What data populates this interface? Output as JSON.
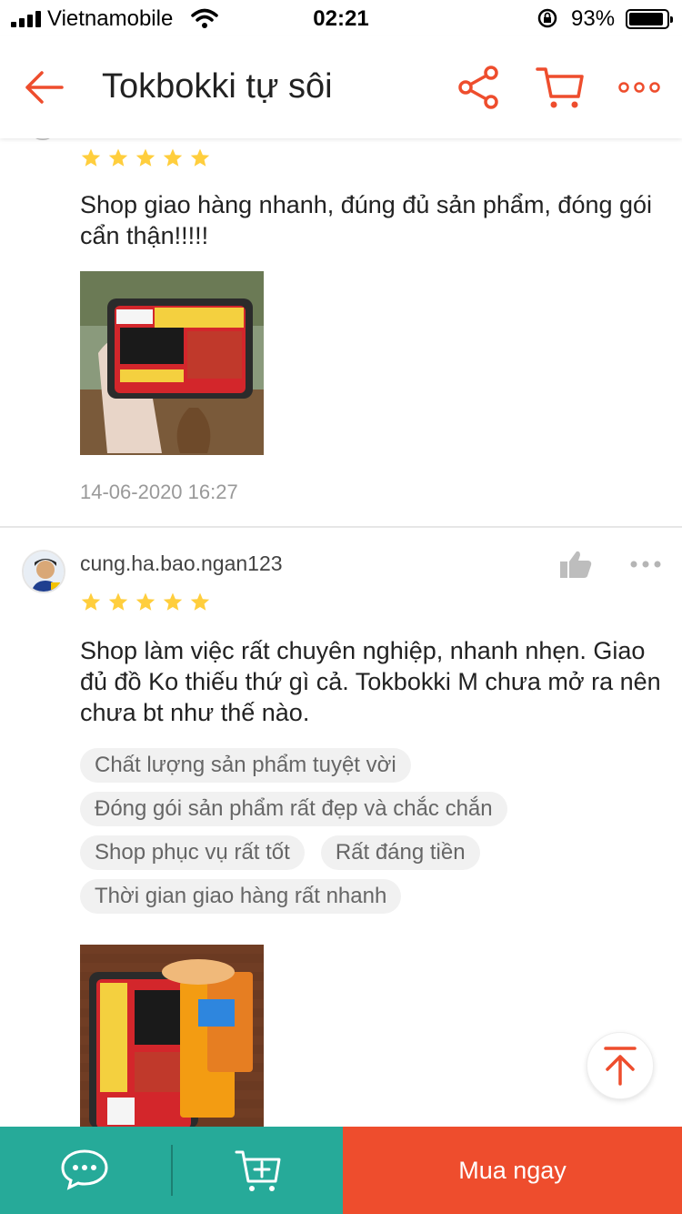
{
  "status_bar": {
    "carrier": "Vietnamobile",
    "time": "02:21",
    "battery_percent": "93%",
    "battery_level": 0.93
  },
  "header": {
    "title": "Tokbokki tự sôi",
    "icons": [
      "back-arrow-icon",
      "share-icon",
      "cart-icon",
      "more-icon"
    ]
  },
  "colors": {
    "accent": "#ee4d2d",
    "teal": "#26aa99",
    "star": "#ffce3d"
  },
  "reviews": [
    {
      "rating": 5,
      "text": "Shop giao hàng nhanh, đúng đủ sản phẩm, đóng gói cẩn thận!!!!!",
      "timestamp": "14-06-2020 16:27"
    },
    {
      "username": "cung.ha.bao.ngan123",
      "rating": 5,
      "text": "Shop làm việc rất chuyên nghiệp, nhanh nhẹn. Giao đủ đồ Ko thiếu thứ gì cả. Tokbokki M chưa mở ra nên chưa bt như thế nào.",
      "tags": [
        "Chất lượng sản phẩm tuyệt vời",
        "Đóng gói sản phẩm rất đẹp và chắc chắn",
        "Shop phục vụ rất tốt",
        "Rất đáng tiền",
        "Thời gian giao hàng rất nhanh"
      ]
    }
  ],
  "bottom_bar": {
    "buy_now": "Mua ngay"
  }
}
